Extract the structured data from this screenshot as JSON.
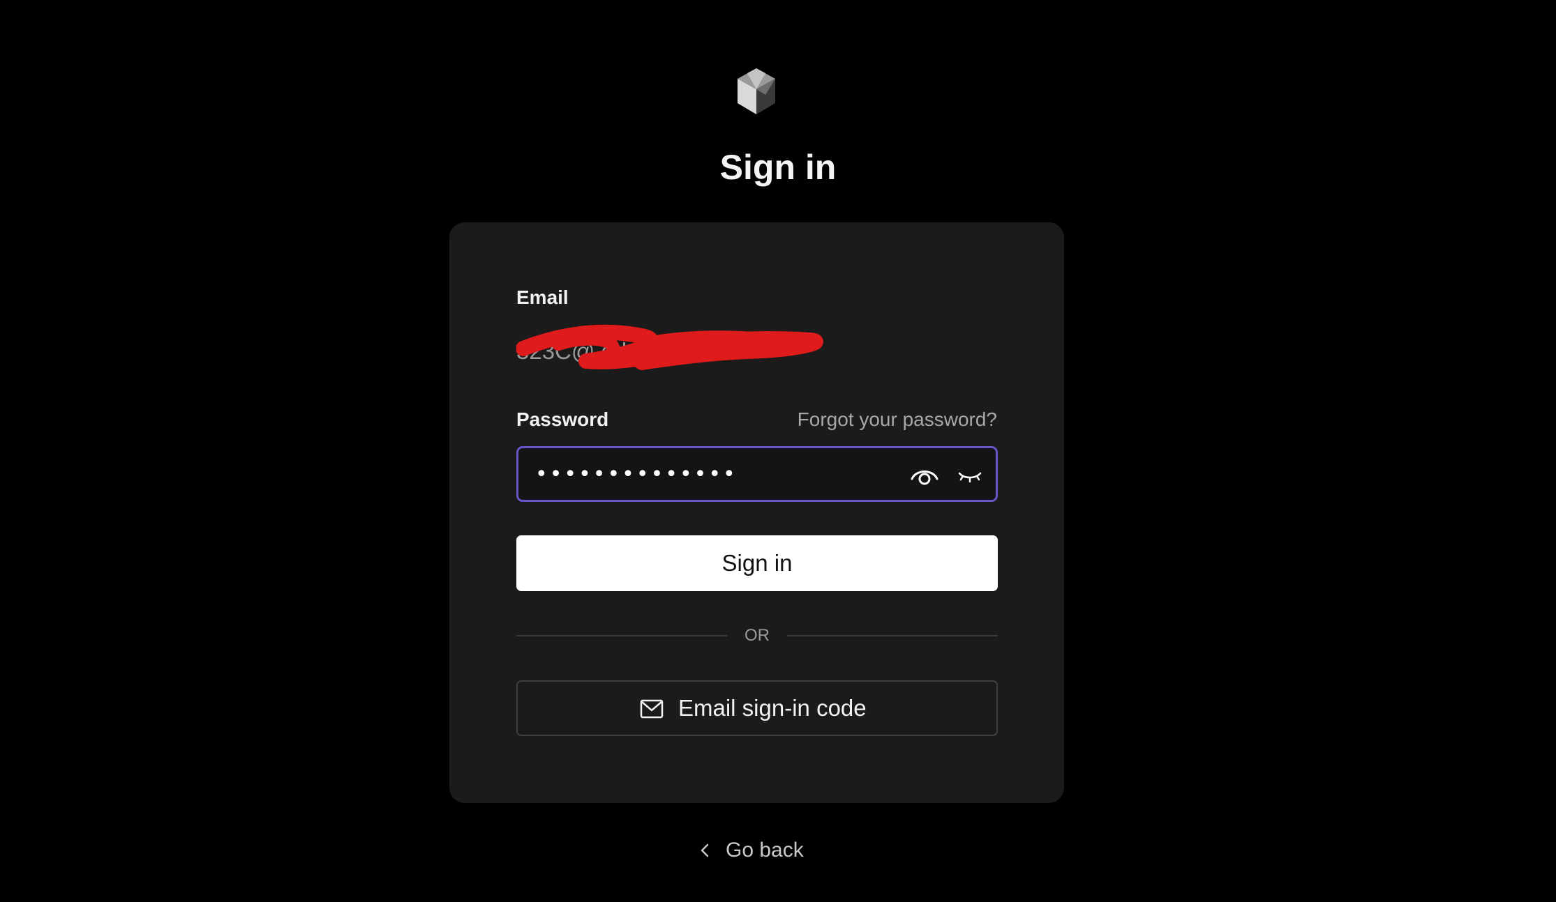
{
  "header": {
    "logo_icon": "cube-logo-icon",
    "title": "Sign in"
  },
  "form": {
    "email_label": "Email",
    "email_value": "323C@.edu.cn",
    "password_label": "Password",
    "forgot_link": "Forgot your password?",
    "password_value": "••••••••••••••",
    "show_password_icon": "eye-icon",
    "hide_password_icon": "eye-closed-icon",
    "signin_button": "Sign in",
    "divider_text": "OR",
    "email_code_icon": "mail-icon",
    "email_code_button": "Email sign-in code"
  },
  "footer": {
    "back_icon": "chevron-left-icon",
    "back_label": "Go back"
  },
  "colors": {
    "page_background": "#000000",
    "card_background": "#1b1b1b",
    "focus_border": "#6b56c8",
    "primary_button": "#ffffff"
  }
}
